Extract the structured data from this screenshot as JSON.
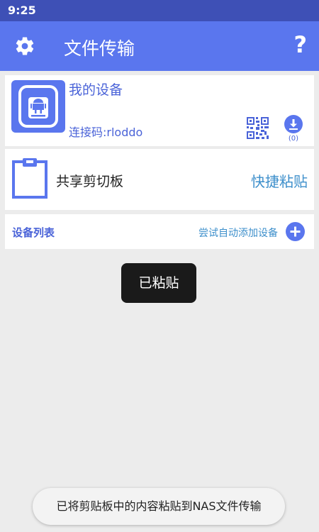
{
  "status_bar": {
    "time": "9:25"
  },
  "app_bar": {
    "title": "文件传输",
    "help_label": "?"
  },
  "device": {
    "name": "我的设备",
    "code": "连接码:rloddo",
    "download_count": "(0)"
  },
  "clipboard": {
    "label": "共享剪切板",
    "paste_button": "快捷粘贴"
  },
  "device_list": {
    "title": "设备列表",
    "auto_add": "尝试自动添加设备"
  },
  "toast": {
    "text": "已粘贴"
  },
  "snackbar": {
    "text": "已将剪贴板中的内容粘贴到NAS文件传输"
  },
  "colors": {
    "primary": "#5a76ee",
    "status_bar": "#3e50b6",
    "accent_text": "#3d8fcb"
  }
}
